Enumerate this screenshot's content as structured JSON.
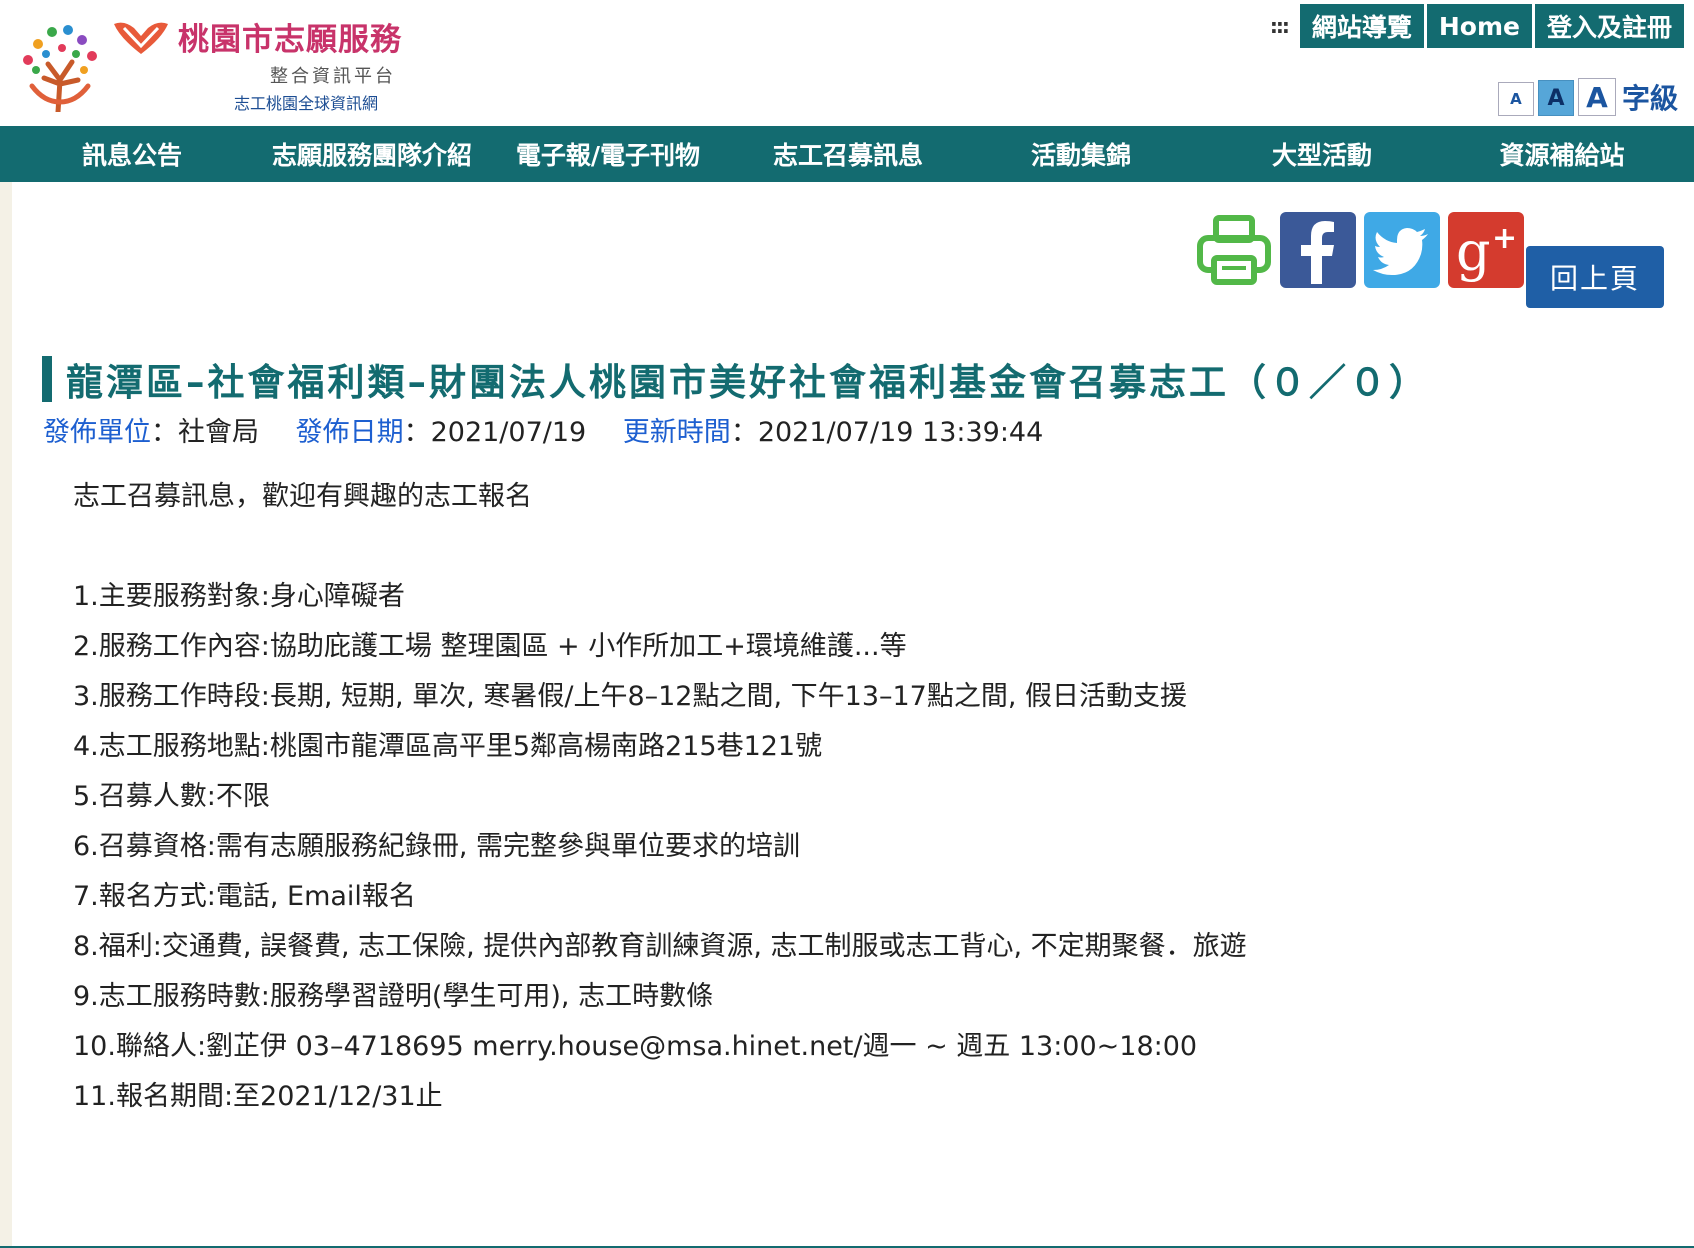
{
  "header": {
    "logo_title": "桃園市志願服務",
    "logo_sub": "整合資訊平台",
    "logo_sub2": "志工桃園全球資訊網",
    "topnav": [
      "網站導覽",
      "Home",
      "登入及註冊"
    ],
    "fontsize": {
      "small": "A",
      "mid": "A",
      "large": "A",
      "label": "字級"
    }
  },
  "mainnav": [
    "訊息公告",
    "志願服務團隊介紹",
    "電子報/電子刊物",
    "志工召募訊息",
    "活動集錦",
    "大型活動",
    "資源補給站"
  ],
  "back_label": "回上頁",
  "article": {
    "title": "龍潭區–社會福利類–財團法人桃園市美好社會福利基金會召募志工（０／０）",
    "meta": {
      "unit_key": "發佈單位",
      "unit_val": "社會局",
      "date_key": "發佈日期",
      "date_val": "2021/07/19",
      "update_key": "更新時間",
      "update_val": "2021/07/19 13:39:44"
    },
    "intro": "志工召募訊息，歡迎有興趣的志工報名",
    "items": [
      "1.主要服務對象:身心障礙者",
      "2.服務工作內容:協助庇護工場 整理園區 + 小作所加工+環境維護...等",
      "3.服務工作時段:長期, 短期, 單次, 寒暑假/上午8–12點之間, 下午13–17點之間, 假日活動支援",
      "4.志工服務地點:桃園市龍潭區高平里5鄰高楊南路215巷121號",
      "5.召募人數:不限",
      "6.召募資格:需有志願服務紀錄冊, 需完整參與單位要求的培訓",
      "7.報名方式:電話, Email報名",
      "8.福利:交通費, 誤餐費, 志工保險, 提供內部教育訓練資源, 志工制服或志工背心, 不定期聚餐．旅遊",
      "9.志工服務時數:服務學習證明(學生可用), 志工時數條",
      "10.聯絡人:劉芷伊 03–4718695 merry.house@msa.hinet.net/週一 ~ 週五 13:00~18:00",
      "11.報名期間:至2021/12/31止"
    ]
  },
  "colors": {
    "brand": "#136b70",
    "link": "#1d5fd0",
    "logo": "#c8336a"
  }
}
